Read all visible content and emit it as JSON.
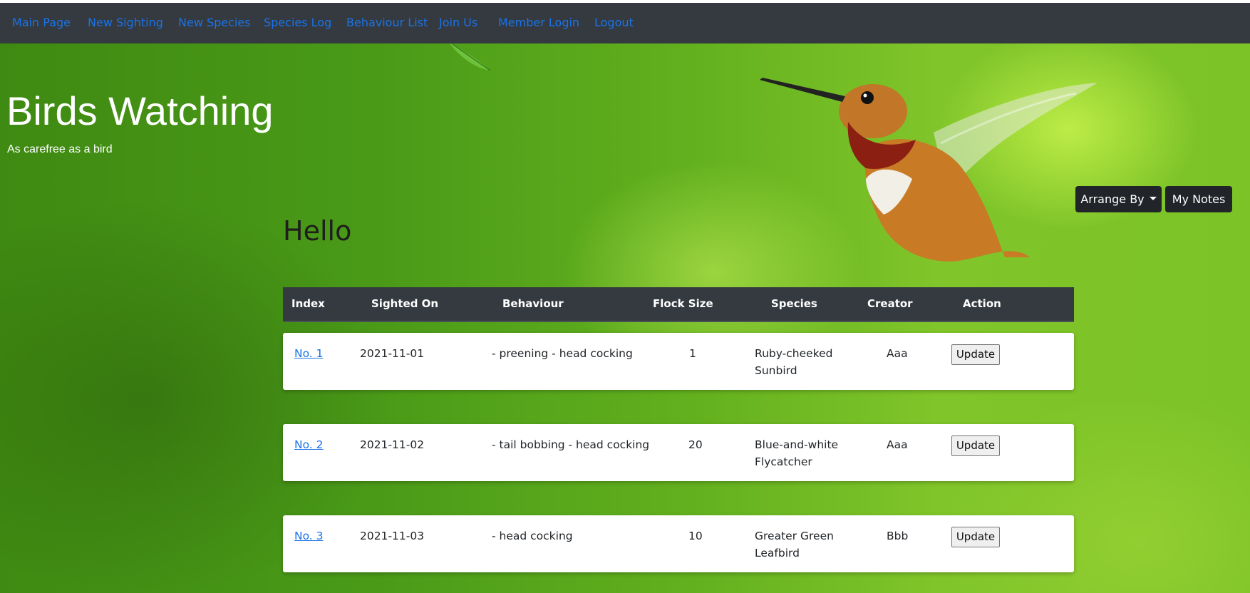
{
  "nav": {
    "items": [
      "Main Page",
      "New Sighting",
      "New Species",
      "Species Log",
      "Behaviour List",
      "Join Us",
      "Member Login",
      "Logout"
    ]
  },
  "header": {
    "title": "Birds Watching",
    "tagline": "As carefree as a bird"
  },
  "toolbar": {
    "arrange_label": "Arrange By",
    "notes_label": "My Notes"
  },
  "main": {
    "greeting": "Hello"
  },
  "table": {
    "columns": [
      "Index",
      "Sighted On",
      "Behaviour",
      "Flock Size",
      "Species",
      "Creator",
      "Action"
    ],
    "rows": [
      {
        "index": "No. 1",
        "date": "2021-11-01",
        "behaviour": "- preening - head cocking",
        "flock": "1",
        "species": "Ruby-cheeked Sunbird",
        "creator": "Aaa",
        "action": "Update"
      },
      {
        "index": "No. 2",
        "date": "2021-11-02",
        "behaviour": "- tail bobbing - head cocking",
        "flock": "20",
        "species": "Blue-and-white Flycatcher",
        "creator": "Aaa",
        "action": "Update"
      },
      {
        "index": "No. 3",
        "date": "2021-11-03",
        "behaviour": "- head cocking",
        "flock": "10",
        "species": "Greater Green Leafbird",
        "creator": "Bbb",
        "action": "Update"
      }
    ]
  },
  "colors": {
    "navbar_bg": "#343a40",
    "nav_link": "#1a73e8",
    "table_header_bg": "#343a40",
    "button_dark": "#212529",
    "index_link": "#1a73e8"
  },
  "icons": {
    "arrange_caret": "caret-down-icon",
    "hero_image": "hummingbird-image"
  }
}
